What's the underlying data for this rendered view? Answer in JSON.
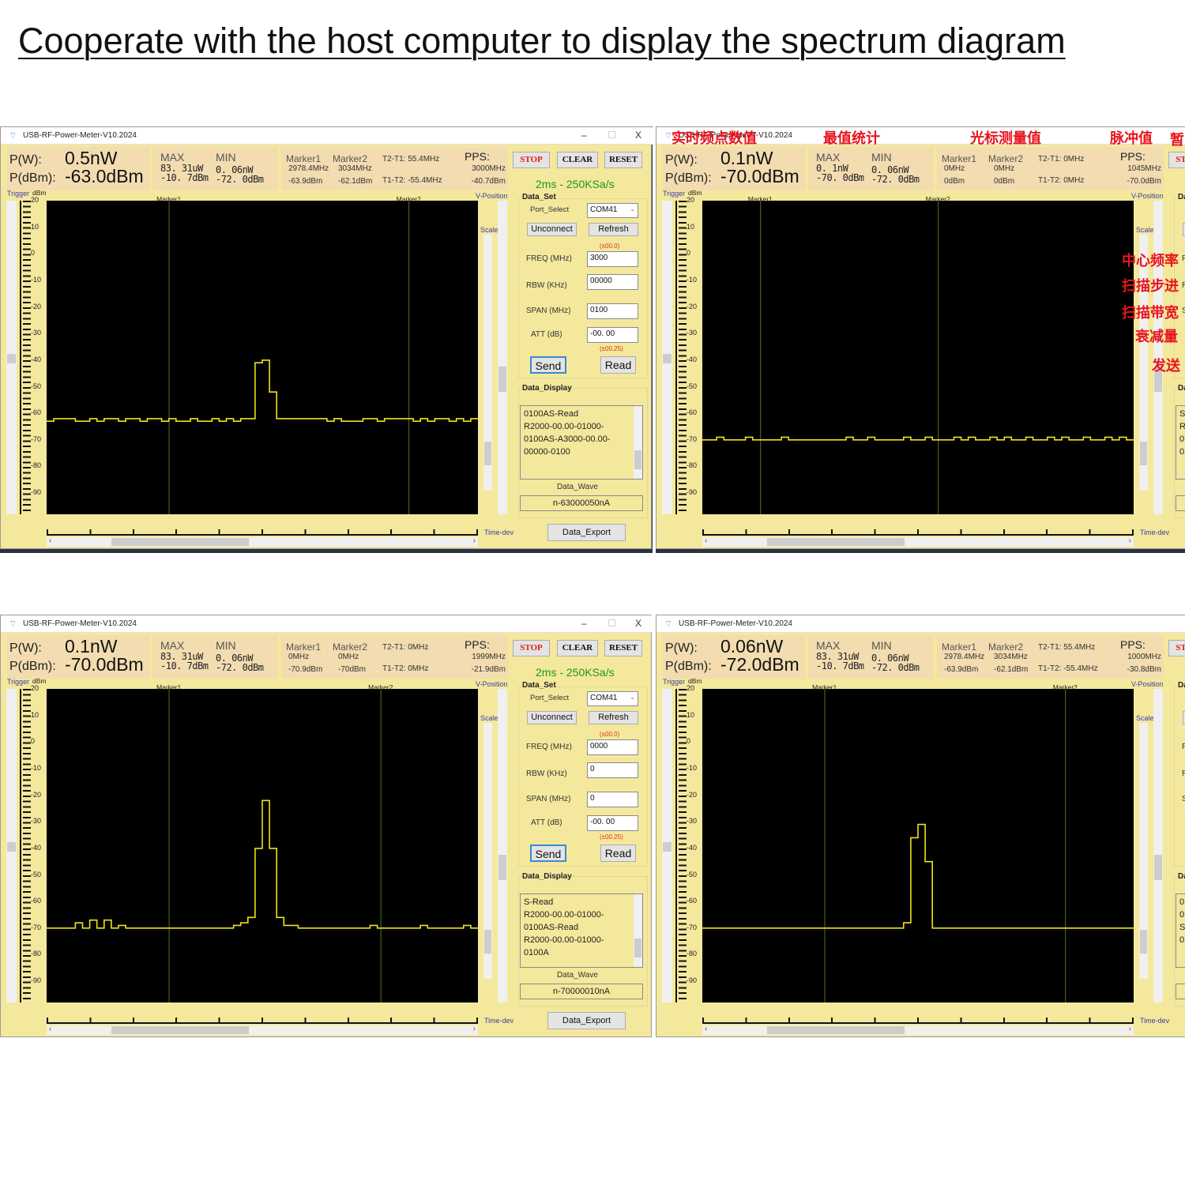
{
  "page_title": "Cooperate with the host computer to display the spectrum diagram",
  "labels": {
    "pw": "P(W):",
    "pdbm": "P(dBm):",
    "max": "MAX",
    "min": "MIN",
    "marker1": "Marker1",
    "marker2": "Marker2",
    "pps": "PPS:",
    "stop": "STOP",
    "clear": "CLEAR",
    "reset": "RESET",
    "data_set": "Data_Set",
    "port_select": "Port_Select",
    "unconnect": "Unconnect",
    "refresh": "Refresh",
    "freq_tol": "(±00.0)",
    "freq": "FREQ (MHz)",
    "rbw": "RBW (KHz)",
    "span": "SPAN (MHz)",
    "att": "ATT (dB)",
    "att_tol": "(±00.25)",
    "send": "Send",
    "read": "Read",
    "data_display": "Data_Display",
    "data_wave": "Data_Wave",
    "data_export": "Data_Export",
    "trigger": "Trigger",
    "dbm": "dBm",
    "v_position": "V-Position",
    "scale": "Scale",
    "time_dev": "Time-dev",
    "minimize": "–",
    "maximize": "☐",
    "close": "X"
  },
  "axis": {
    "y_ticks": [
      "20",
      "10",
      "0",
      "-10",
      "-20",
      "-30",
      "-40",
      "-50",
      "-60",
      "-70",
      "-80",
      "-90"
    ],
    "y_range_dbm": [
      20,
      -98
    ]
  },
  "colors": {
    "trace": "#f0e020",
    "marker_line": "#4a7a18",
    "panel_bg": "#f4e89c",
    "rate_text": "#1a9a1a",
    "annotation": "#e8141c"
  },
  "panels": [
    {
      "title": "USB-RF-Power-Meter-V10.2024",
      "pw": "0.5nW",
      "pdbm": "-63.0dBm",
      "max_w": "83. 31uW",
      "max_dbm": "-10. 7dBm",
      "min_w": "0. 06nW",
      "min_dbm": "-72. 0dBm",
      "marker1_freq": "2978.4MHz",
      "marker1_dbm": "-63.9dBm",
      "marker2_freq": "3034MHz",
      "marker2_dbm": "-62.1dBm",
      "t2t1": "T2-T1: 55.4MHz",
      "t1t2": "T1-T2: -55.4MHz",
      "pps_freq": "3000MHz",
      "pps_dbm": "-40.7dBm",
      "rate": "2ms - 250KSa/s",
      "port": "COM41",
      "freq": "3000",
      "rbw": "00000",
      "span": "0100",
      "att": "-00. 00",
      "display": "0100AS-Read\nR2000-00.00-01000-\n0100AS-A3000-00.00-\n00000-0100",
      "data_wave": "n-63000050nA",
      "marker_positions": [
        0.284,
        0.84
      ],
      "trace_dbm": [
        -63,
        -62,
        -62,
        -62,
        -63,
        -63,
        -62,
        -63,
        -62,
        -62,
        -63,
        -62,
        -62,
        -63,
        -62,
        -62,
        -63,
        -62,
        -63,
        -63,
        -62,
        -63,
        -63,
        -62,
        -63,
        -62,
        -63,
        -62,
        -62,
        -41,
        -40,
        -52,
        -62,
        -62,
        -62,
        -62,
        -62,
        -62,
        -62,
        -63,
        -62,
        -63,
        -63,
        -63,
        -62,
        -62,
        -63,
        -62,
        -62,
        -62,
        -62,
        -63,
        -62,
        -63,
        -62,
        -62,
        -63,
        -62,
        -63,
        -62
      ]
    },
    {
      "title": "USB-RF-Power-Meter-V10.2024",
      "pw": "0.1nW",
      "pdbm": "-70.0dBm",
      "max_w": "0. 1nW",
      "max_dbm": "-70. 0dBm",
      "min_w": "0. 06nW",
      "min_dbm": "-72. 0dBm",
      "marker1_freq": "0MHz",
      "marker1_dbm": "0dBm",
      "marker2_freq": "0MHz",
      "marker2_dbm": "0dBm",
      "t2t1": "T2-T1: 0MHz",
      "t1t2": "T1-T2: 0MHz",
      "pps_freq": "1045MHz",
      "pps_dbm": "-70.0dBm",
      "display": "S\nR\n0\n0",
      "marker_positions": [
        0.135,
        0.547
      ],
      "trace_dbm": [
        -70,
        -70,
        -69,
        -70,
        -70,
        -70,
        -69,
        -70,
        -70,
        -70,
        -70,
        -69,
        -70,
        -70,
        -70,
        -70,
        -70,
        -70,
        -70,
        -70,
        -69,
        -70,
        -70,
        -69,
        -70,
        -70,
        -70,
        -70,
        -69,
        -70,
        -70,
        -69,
        -70,
        -70,
        -70,
        -69,
        -70,
        -69,
        -70,
        -70,
        -69,
        -70,
        -69,
        -70,
        -70,
        -69,
        -70,
        -70,
        -69,
        -70,
        -69,
        -70,
        -70,
        -69,
        -70,
        -70,
        -69,
        -70,
        -69,
        -70
      ],
      "annotations": {
        "realtime": "实时频点数值",
        "stats": "最值统计",
        "cursor": "光标测量值",
        "pulse": "脉冲值",
        "pause": "暂",
        "center_freq": "中心频率",
        "scan_step": "扫描步进",
        "scan_bw": "扫描带宽",
        "attenuation": "衰减量",
        "send": "发送"
      }
    },
    {
      "title": "USB-RF-Power-Meter-V10.2024",
      "pw": "0.1nW",
      "pdbm": "-70.0dBm",
      "max_w": "83. 31uW",
      "max_dbm": "-10. 7dBm",
      "min_w": "0. 06nW",
      "min_dbm": "-72. 0dBm",
      "marker1_freq": "0MHz",
      "marker1_dbm": "-70.9dBm",
      "marker2_freq": "0MHz",
      "marker2_dbm": "-70dBm",
      "t2t1": "T2-T1: 0MHz",
      "t1t2": "T1-T2: 0MHz",
      "pps_freq": "1999MHz",
      "pps_dbm": "-21.9dBm",
      "rate": "2ms - 250KSa/s",
      "port": "COM41",
      "freq": "0000",
      "rbw": "0",
      "span": "0",
      "att": "-00. 00",
      "display": "S-Read\nR2000-00.00-01000-\n0100AS-Read\nR2000-00.00-01000-\n0100A",
      "data_wave": "n-70000010nA",
      "marker_positions": [
        0.284,
        0.775
      ],
      "trace_dbm": [
        -70,
        -70,
        -70,
        -70,
        -68,
        -70,
        -67,
        -70,
        -67,
        -70,
        -69,
        -70,
        -70,
        -70,
        -70,
        -70,
        -70,
        -70,
        -70,
        -70,
        -70,
        -70,
        -70,
        -70,
        -70,
        -70,
        -69,
        -68,
        -66,
        -40,
        -22,
        -40,
        -66,
        -69,
        -69,
        -70,
        -70,
        -70,
        -70,
        -70,
        -70,
        -70,
        -70,
        -70,
        -70,
        -69,
        -70,
        -70,
        -70,
        -70,
        -70,
        -70,
        -69,
        -70,
        -70,
        -70,
        -70,
        -70,
        -69,
        -70
      ]
    },
    {
      "title": "USB-RF-Power-Meter-V10.2024",
      "pw": "0.06nW",
      "pdbm": "-72.0dBm",
      "max_w": "83. 31uW",
      "max_dbm": "-10. 7dBm",
      "min_w": "0. 06nW",
      "min_dbm": "-72. 0dBm",
      "marker1_freq": "2978.4MHz",
      "marker1_dbm": "-63.9dBm",
      "marker2_freq": "3034MHz",
      "marker2_dbm": "-62.1dBm",
      "t2t1": "T2-T1: 55.4MHz",
      "t1t2": "T1-T2: -55.4MHz",
      "pps_freq": "1000MHz",
      "pps_dbm": "-30.8dBm",
      "display": "0\n0\nS\n0",
      "marker_positions": [
        0.284,
        0.842
      ],
      "trace_dbm": [
        -70,
        -70,
        -70,
        -70,
        -70,
        -70,
        -70,
        -70,
        -70,
        -70,
        -70,
        -70,
        -70,
        -70,
        -70,
        -70,
        -70,
        -70,
        -70,
        -70,
        -70,
        -70,
        -70,
        -70,
        -70,
        -70,
        -70,
        -70,
        -68,
        -36,
        -31,
        -45,
        -70,
        -70,
        -70,
        -70,
        -70,
        -70,
        -70,
        -70,
        -70,
        -70,
        -70,
        -70,
        -70,
        -70,
        -70,
        -70,
        -70,
        -70,
        -70,
        -70,
        -70,
        -70,
        -70,
        -70,
        -70,
        -70,
        -70,
        -70
      ]
    }
  ]
}
